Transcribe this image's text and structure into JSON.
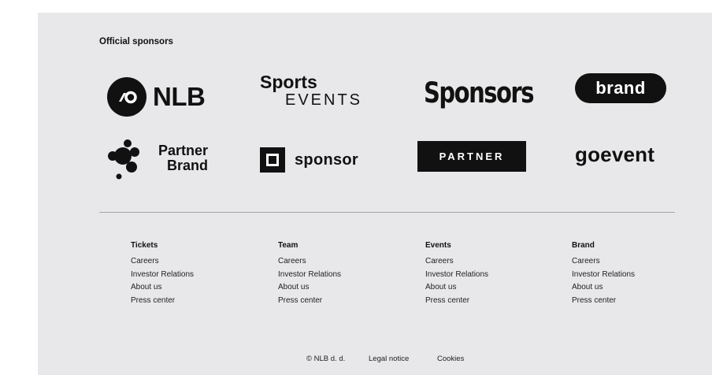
{
  "section_title": "Official sponsors",
  "logos": {
    "nlb": "NLB",
    "sports_line1": "Sports",
    "sports_line2": "EVENTS",
    "sponsors": "Sponsors",
    "brand": "brand",
    "partner_brand_line1": "Partner",
    "partner_brand_line2": "Brand",
    "sponsor": "sponsor",
    "partner": "PARTNER",
    "goevent": "goevent"
  },
  "footer": {
    "columns": [
      {
        "heading": "Tickets",
        "links": [
          "Careers",
          "Investor Relations",
          "About us",
          "Press center"
        ]
      },
      {
        "heading": "Team",
        "links": [
          "Careers",
          "Investor Relations",
          "About us",
          "Press center"
        ]
      },
      {
        "heading": "Events",
        "links": [
          "Careers",
          "Investor Relations",
          "About us",
          "Press center"
        ]
      },
      {
        "heading": "Brand",
        "links": [
          "Careers",
          "Investor Relations",
          "About us",
          "Press center"
        ]
      }
    ],
    "copyright": "© NLB d. d.",
    "legal": "Legal notice",
    "cookies": "Cookies"
  },
  "colors": {
    "panel_bg": "#e8e8ea",
    "logo": "#111111",
    "divider": "#a6a6a8"
  },
  "icons": [
    "nlb-mark-icon",
    "partner-brand-bubbles-icon",
    "sponsor-square-icon"
  ]
}
